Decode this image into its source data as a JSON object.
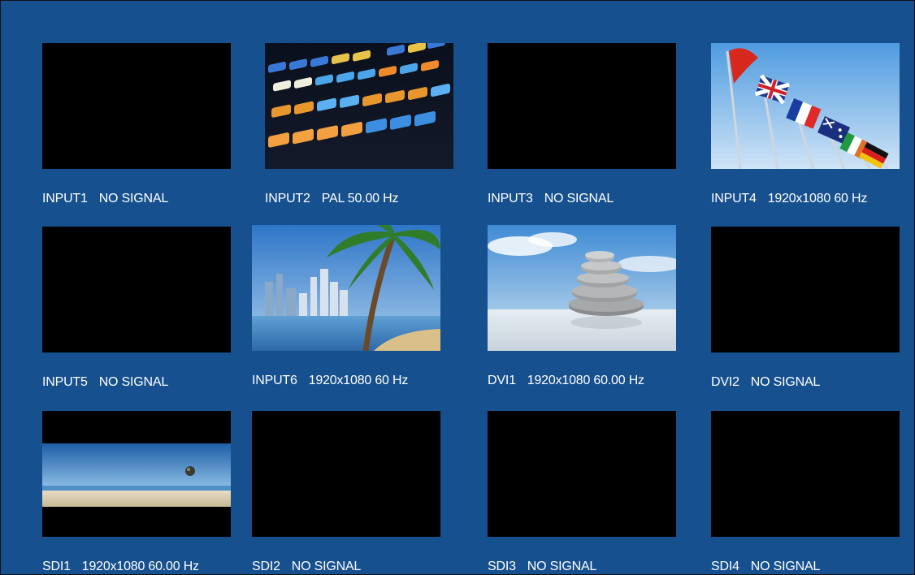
{
  "tiles": [
    {
      "name": "INPUT1",
      "status": "NO SIGNAL",
      "image": "none"
    },
    {
      "name": "INPUT2",
      "status": "PAL  50.00 Hz",
      "image": "control-panel-buttons"
    },
    {
      "name": "INPUT3",
      "status": "NO SIGNAL",
      "image": "none"
    },
    {
      "name": "INPUT4",
      "status": "1920x1080   60 Hz",
      "image": "flags-on-poles"
    },
    {
      "name": "INPUT5",
      "status": "NO SIGNAL",
      "image": "none"
    },
    {
      "name": "INPUT6",
      "status": "1920x1080   60 Hz",
      "image": "palm-tree-city-skyline"
    },
    {
      "name": "DVI1",
      "status": "1920x1080   60.00 Hz",
      "image": "stacked-stones"
    },
    {
      "name": "DVI2",
      "status": "NO SIGNAL",
      "image": "none"
    },
    {
      "name": "SDI1",
      "status": "1920x1080   60.00 Hz",
      "image": "beach-panorama-letterbox"
    },
    {
      "name": "SDI2",
      "status": "NO SIGNAL",
      "image": "none"
    },
    {
      "name": "SDI3",
      "status": "NO SIGNAL",
      "image": "none"
    },
    {
      "name": "SDI4",
      "status": "NO SIGNAL",
      "image": "none"
    }
  ],
  "colors": {
    "background": "#16508f",
    "no_signal": "#000000",
    "label_text": "#ffffff"
  }
}
